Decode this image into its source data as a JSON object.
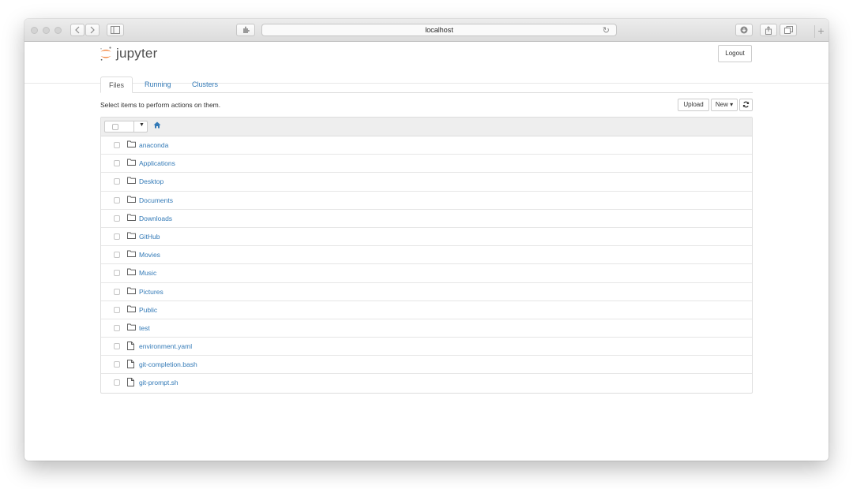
{
  "browser": {
    "address": "localhost",
    "reload_glyph": "↻",
    "new_tab_glyph": "+"
  },
  "app": {
    "logo_text": "jupyter",
    "logout_label": "Logout"
  },
  "tabs": [
    {
      "label": "Files",
      "active": true
    },
    {
      "label": "Running",
      "active": false
    },
    {
      "label": "Clusters",
      "active": false
    }
  ],
  "toolbar": {
    "hint": "Select items to perform actions on them.",
    "upload_label": "Upload",
    "new_label": "New ▾",
    "refresh_icon": "refresh-icon"
  },
  "files": [
    {
      "name": "anaconda",
      "type": "folder"
    },
    {
      "name": "Applications",
      "type": "folder"
    },
    {
      "name": "Desktop",
      "type": "folder"
    },
    {
      "name": "Documents",
      "type": "folder"
    },
    {
      "name": "Downloads",
      "type": "folder"
    },
    {
      "name": "GitHub",
      "type": "folder"
    },
    {
      "name": "Movies",
      "type": "folder"
    },
    {
      "name": "Music",
      "type": "folder"
    },
    {
      "name": "Pictures",
      "type": "folder"
    },
    {
      "name": "Public",
      "type": "folder"
    },
    {
      "name": "test",
      "type": "folder"
    },
    {
      "name": "environment.yaml",
      "type": "file"
    },
    {
      "name": "git-completion.bash",
      "type": "file"
    },
    {
      "name": "git-prompt.sh",
      "type": "file"
    }
  ],
  "colors": {
    "link": "#337ab7",
    "logo_orange": "#f37726",
    "header_bg": "#eeeeee"
  }
}
